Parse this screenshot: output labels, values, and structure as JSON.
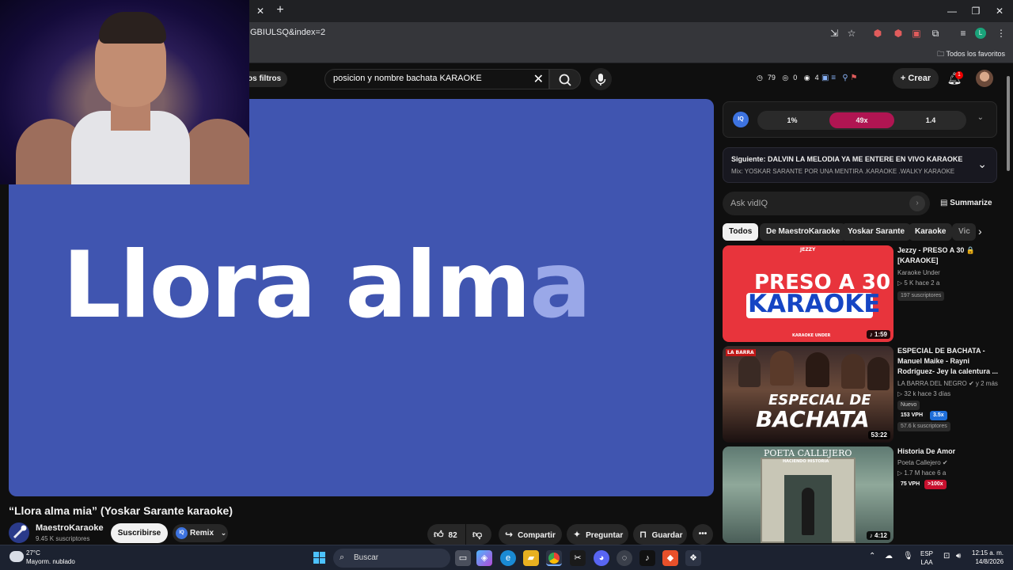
{
  "browser": {
    "tab_close": "✕",
    "tab_new": "+",
    "url_visible": "GBIULSQ&index=2",
    "bookmarks_folder": "Todos los favoritos",
    "window_controls": [
      "—",
      "❐",
      "✕"
    ]
  },
  "header": {
    "filters_label": "os filtros",
    "search_query": "posicion y nombre bachata KARAOKE",
    "stats": {
      "views": "79",
      "comments": "0",
      "watching": "4"
    },
    "create_label": "Crear",
    "notifications_count": "1"
  },
  "player": {
    "lyric_main": "Llora alm",
    "lyric_dim": "a",
    "background_color": "#4055b0"
  },
  "video": {
    "title": "“Llora alma mia” (Yoskar Sarante karaoke)",
    "channel_name": "MaestroKaraoke",
    "channel_subs": "9.45 K suscriptores",
    "subscribe_label": "Suscribirse",
    "remix_label": "Remix",
    "remix_icon_text": "IQ",
    "likes": "82",
    "share_label": "Compartir",
    "ask_label": "Preguntar",
    "save_label": "Guardar"
  },
  "vidiq": {
    "logo_text": "IQ",
    "metrics": [
      "1%",
      "49x",
      "1.4"
    ],
    "accent": "#c2185b"
  },
  "up_next": {
    "line1": "Siguiente: DALVIN LA MELODIA YA ME ENTERE EN VIVO KARAOKE",
    "line2": "Mix: YOSKAR SARANTE POR UNA MENTIRA .KARAOKE .WALKY KARAOKE"
  },
  "ask": {
    "placeholder": "Ask vidIQ",
    "summarize_label": "Summarize"
  },
  "chips": [
    "Todos",
    "De MaestroKaraoke",
    "Yoskar Sarante",
    "Karaoke",
    "Vic"
  ],
  "recommendations": [
    {
      "title": "Jezzy - PRESO A 30 🔒 [KARAOKE]",
      "channel": "Karaoke Under",
      "meta": "▷ 5 K   hace 2 a",
      "subs_tag": "197 suscriptores",
      "duration": "♪ 1:59",
      "thumb_line1": "PRESO A 30",
      "thumb_line2": "KARAOKE",
      "thumb_top": "JEZZY",
      "thumb_bottom": "KARAOKE UNDER"
    },
    {
      "title": "ESPECIAL DE BACHATA - Manuel Maike - Rayni Rodríguez- Jey la calentura ...",
      "channel": "LA BARRA DEL NEGRO ✔ y 2 más",
      "meta": "▷ 32 k   hace 3 días",
      "new_tag": "Nuevo",
      "vph": "153 VPH",
      "multiplier": "3.5x",
      "subs_tag": "57.6 k suscriptores",
      "duration": "53:22",
      "thumb_line1": "ESPECIAL DE",
      "thumb_line2": "BACHATA",
      "thumb_top": "LA BARRA"
    },
    {
      "title": "Historia De Amor",
      "channel": "Poeta Callejero ✔",
      "meta": "▷ 1.7 M   hace 6 a",
      "vph": "75 VPH",
      "multiplier": ">100x",
      "duration": "♪ 4:12",
      "thumb_top": "POETA CALLEJERO",
      "thumb_sub": "HACIENDO HISTORIA"
    }
  ],
  "taskbar": {
    "temp": "27°C",
    "weather": "Mayorm. nublado",
    "search_label": "Buscar",
    "lang1": "ESP",
    "lang2": "LAA",
    "time": "12:15 a. m.",
    "date": "14/8/2026"
  }
}
